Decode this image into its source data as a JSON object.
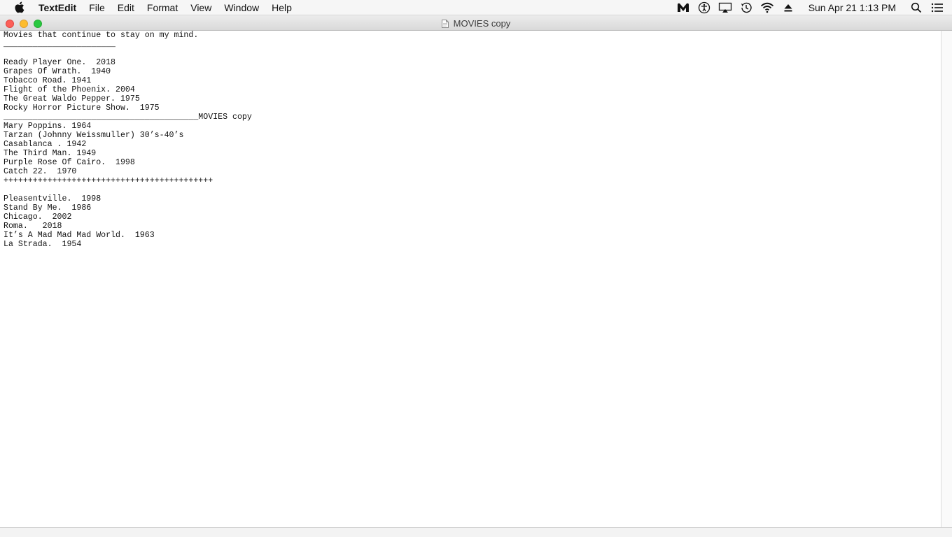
{
  "menubar": {
    "app_name": "TextEdit",
    "items": [
      "File",
      "Edit",
      "Format",
      "View",
      "Window",
      "Help"
    ],
    "clock": "Sun Apr 21  1:13 PM",
    "status_icons": [
      "malwarebytes-icon",
      "accessibility-icon",
      "airplay-icon",
      "time-machine-icon",
      "wifi-icon",
      "eject-icon",
      "spotlight-search-icon",
      "notification-center-icon"
    ]
  },
  "window": {
    "title": "MOVIES copy"
  },
  "document": {
    "lines": [
      "Movies that continue to stay on my mind.",
      "_______________________",
      "",
      "Ready Player One.  2018",
      "Grapes Of Wrath.  1940",
      "Tobacco Road. 1941",
      "Flight of the Phoenix. 2004",
      "The Great Waldo Pepper. 1975",
      "Rocky Horror Picture Show.  1975",
      "________________________________________MOVIES copy",
      "Mary Poppins. 1964",
      "Tarzan (Johnny Weissmuller) 30’s-40’s",
      "Casablanca . 1942",
      "The Third Man. 1949",
      "Purple Rose Of Cairo.  1998",
      "Catch 22.  1970",
      "+++++++++++++++++++++++++++++++++++++++++++",
      "",
      "Pleasentville.  1998",
      "Stand By Me.  1986",
      "Chicago.  2002",
      "Roma.   2018",
      "It’s A Mad Mad Mad World.  1963",
      "La Strada.  1954"
    ]
  },
  "colors": {
    "close": "#fc5f57",
    "minimize": "#fdbc2e",
    "maximize": "#28c840"
  }
}
